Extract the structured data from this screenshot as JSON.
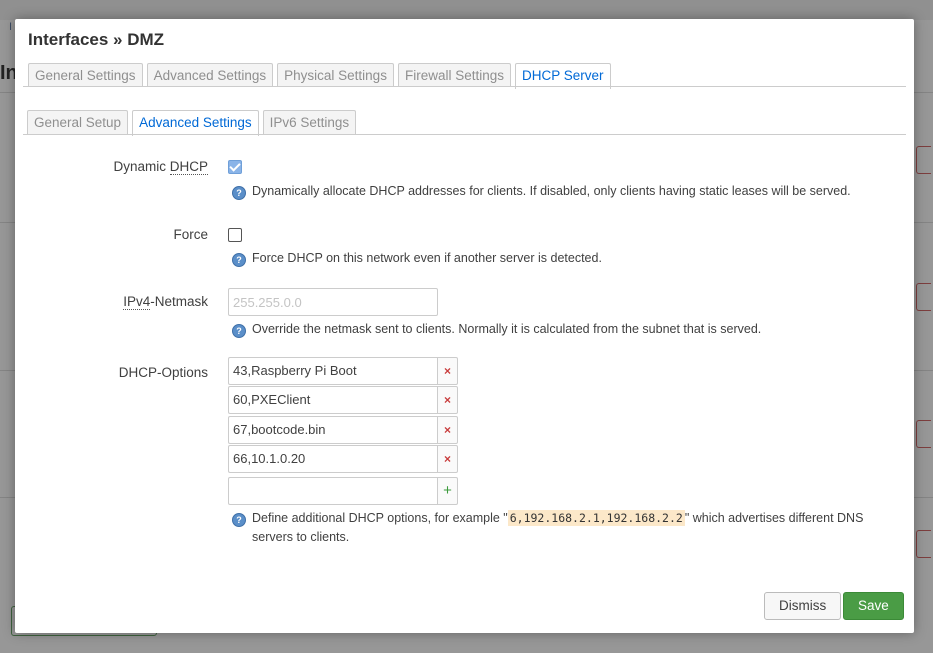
{
  "background": {
    "crumb_text": "I",
    "heading_text": "In"
  },
  "modal": {
    "title": "Interfaces » DMZ",
    "top_tabs": [
      {
        "label": "General Settings",
        "active": false
      },
      {
        "label": "Advanced Settings",
        "active": false
      },
      {
        "label": "Physical Settings",
        "active": false
      },
      {
        "label": "Firewall Settings",
        "active": false
      },
      {
        "label": "DHCP Server",
        "active": true
      }
    ],
    "sub_tabs": [
      {
        "label": "General Setup",
        "active": false
      },
      {
        "label": "Advanced Settings",
        "active": true
      },
      {
        "label": "IPv6 Settings",
        "active": false
      }
    ],
    "dynamic_dhcp": {
      "label_prefix": "Dynamic ",
      "label_abbr": "DHCP",
      "checked": true,
      "help": "Dynamically allocate DHCP addresses for clients. If disabled, only clients having static leases will be served."
    },
    "force": {
      "label": "Force",
      "checked": false,
      "help": "Force DHCP on this network even if another server is detected."
    },
    "netmask": {
      "label_abbr": "IPv4",
      "label_suffix": "-Netmask",
      "value": "",
      "placeholder": "255.255.0.0",
      "help": "Override the netmask sent to clients. Normally it is calculated from the subnet that is served."
    },
    "dhcp_options": {
      "label": "DHCP-Options",
      "values": [
        "43,Raspberry Pi Boot",
        "60,PXEClient",
        "67,bootcode.bin",
        "66,10.1.0.20"
      ],
      "remove_symbol": "×",
      "add_symbol": "+",
      "new_value": "",
      "help_before": "Define additional DHCP options, for example \"",
      "help_code": "6,192.168.2.1,192.168.2.2",
      "help_after": "\" which advertises different DNS servers to clients."
    },
    "help_icon_glyph": "?",
    "buttons": {
      "dismiss": "Dismiss",
      "save": "Save"
    },
    "colors": {
      "accent": "#0069d6",
      "save": "#4a9c45",
      "remove": "#c93c3c",
      "add": "#3b9a3b"
    }
  }
}
